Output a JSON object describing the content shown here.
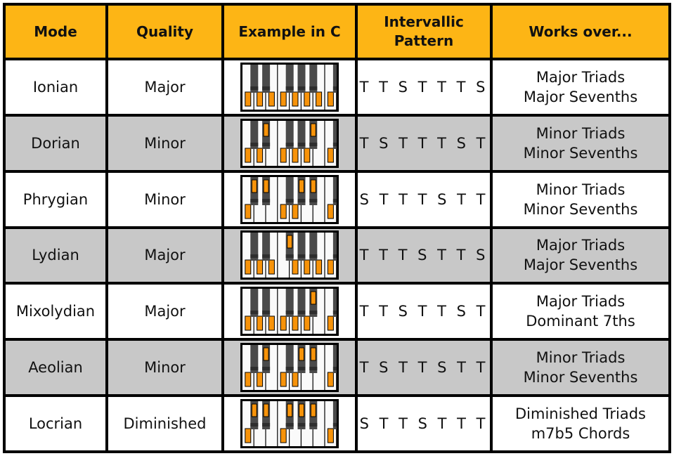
{
  "colors": {
    "header": "#FDB515",
    "alt_row": "#c8c8c8",
    "highlight": "#F7930A"
  },
  "headers": [
    "Mode",
    "Quality",
    "Example in C",
    "Intervallic Pattern",
    "Works over..."
  ],
  "rows": [
    {
      "mode": "Ionian",
      "quality": "Major",
      "highlighted_keys": [
        "C",
        "D",
        "E",
        "F",
        "G",
        "A",
        "B",
        "C2"
      ],
      "pattern": "T T S T T T S",
      "works_over": [
        "Major Triads",
        "Major Sevenths"
      ]
    },
    {
      "mode": "Dorian",
      "quality": "Minor",
      "highlighted_keys": [
        "C",
        "D",
        "Eb",
        "F",
        "G",
        "A",
        "Bb",
        "C2"
      ],
      "pattern": "T S T T T S T",
      "works_over": [
        "Minor Triads",
        "Minor Sevenths"
      ]
    },
    {
      "mode": "Phrygian",
      "quality": "Minor",
      "highlighted_keys": [
        "C",
        "Db",
        "Eb",
        "F",
        "G",
        "Ab",
        "Bb",
        "C2"
      ],
      "pattern": "S T T T S T T",
      "works_over": [
        "Minor Triads",
        "Minor Sevenths"
      ]
    },
    {
      "mode": "Lydian",
      "quality": "Major",
      "highlighted_keys": [
        "C",
        "D",
        "E",
        "F#",
        "G",
        "A",
        "B",
        "C2"
      ],
      "pattern": "T T T S T T S",
      "works_over": [
        "Major Triads",
        "Major Sevenths"
      ]
    },
    {
      "mode": "Mixolydian",
      "quality": "Major",
      "highlighted_keys": [
        "C",
        "D",
        "E",
        "F",
        "G",
        "A",
        "Bb",
        "C2"
      ],
      "pattern": "T T S T T S T",
      "works_over": [
        "Major Triads",
        "Dominant 7ths"
      ]
    },
    {
      "mode": "Aeolian",
      "quality": "Minor",
      "highlighted_keys": [
        "C",
        "D",
        "Eb",
        "F",
        "G",
        "Ab",
        "Bb",
        "C2"
      ],
      "pattern": "T S T T S T T",
      "works_over": [
        "Minor Triads",
        "Minor Sevenths"
      ]
    },
    {
      "mode": "Locrian",
      "quality": "Diminished",
      "highlighted_keys": [
        "C",
        "Db",
        "Eb",
        "F",
        "Gb",
        "Ab",
        "Bb",
        "C2"
      ],
      "pattern": "S T T S T T T",
      "works_over": [
        "Diminished Triads",
        "m7b5 Chords"
      ]
    }
  ]
}
